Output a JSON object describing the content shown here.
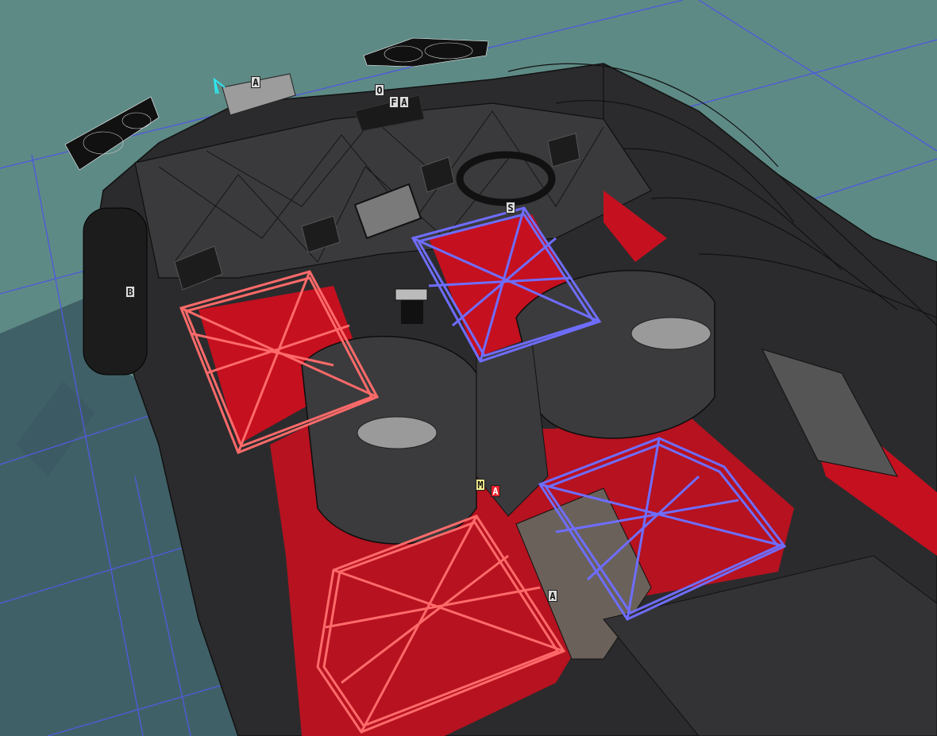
{
  "app": {
    "view": "3D viewport — vehicle interior wireframe"
  },
  "colors": {
    "background": "#5e8a85",
    "ground_grid": "#4f5bd8",
    "body_dark": "#2b2b2d",
    "carpet_red": "#c5101f",
    "seat_outline_red": "#ff6a6a",
    "seat_outline_blue": "#6f6dff",
    "shadow": "#3b5862",
    "axis_cyan": "#2fe8f0"
  },
  "markers": [
    {
      "id": "a_roof",
      "label": "A",
      "style": "gray"
    },
    {
      "id": "o_top",
      "label": "O",
      "style": "gray"
    },
    {
      "id": "f_top",
      "label": "F",
      "style": "gray"
    },
    {
      "id": "a_top",
      "label": "A",
      "style": "gray"
    },
    {
      "id": "s_seat",
      "label": "S",
      "style": "gray"
    },
    {
      "id": "b_wheel",
      "label": "B",
      "style": "gray"
    },
    {
      "id": "m_center",
      "label": "M",
      "style": "yellow"
    },
    {
      "id": "a_center_red",
      "label": "A",
      "style": "red"
    },
    {
      "id": "a_rear",
      "label": "A",
      "style": "gray"
    }
  ],
  "icons": {
    "axis_gizmo": "axis-gizmo-icon",
    "speaker": "speaker-icon"
  }
}
